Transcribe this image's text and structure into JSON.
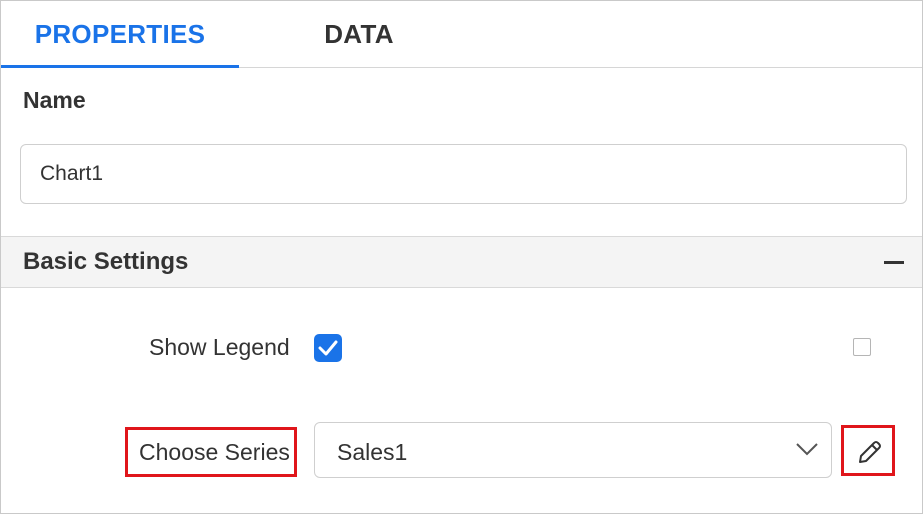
{
  "tabs": [
    {
      "label": "PROPERTIES",
      "active": true
    },
    {
      "label": "DATA",
      "active": false
    }
  ],
  "name_section": {
    "label": "Name",
    "value": "Chart1"
  },
  "basic_settings": {
    "title": "Basic Settings",
    "collapse_icon": "minus-icon",
    "show_legend": {
      "label": "Show Legend",
      "checked": true,
      "aux_checked": false
    },
    "choose_series": {
      "label": "Choose Series",
      "selected": "Sales1",
      "dropdown_icon": "chevron-down-icon",
      "edit_icon": "pencil-icon"
    }
  },
  "colors": {
    "accent": "#1a73e8",
    "highlight": "#e0161b",
    "text": "#333333",
    "section_bg": "#f4f4f4"
  }
}
